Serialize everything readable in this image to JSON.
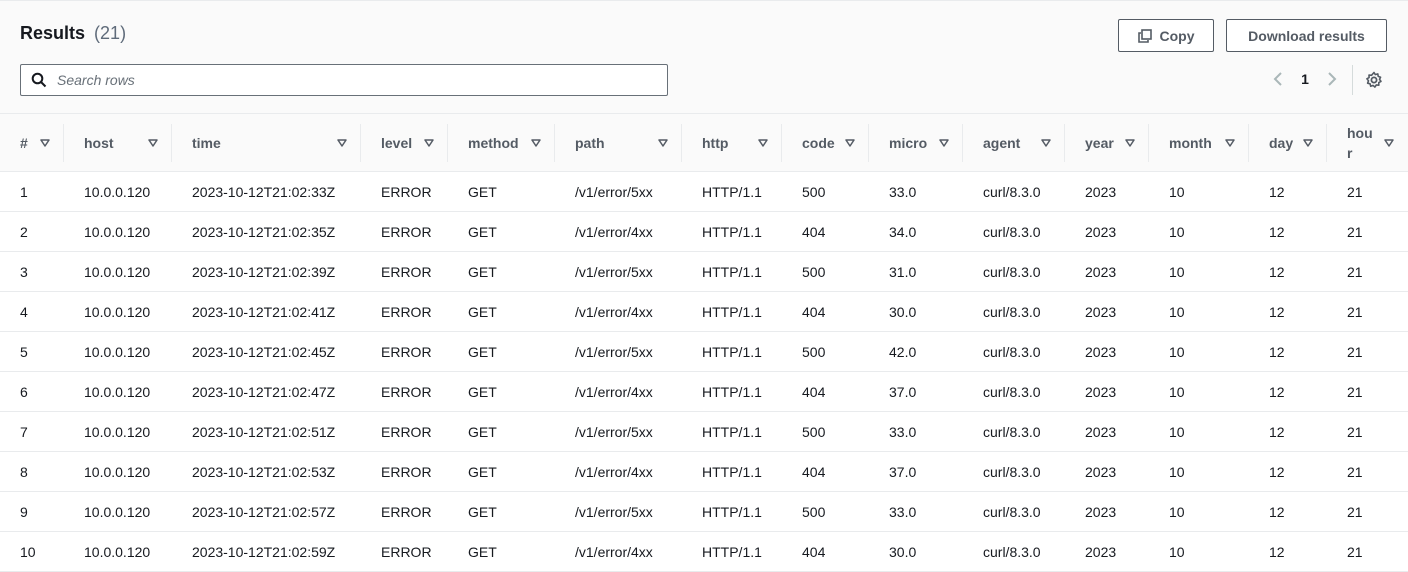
{
  "results": {
    "title": "Results",
    "count": "(21)"
  },
  "toolbar": {
    "copy_label": "Copy",
    "download_label": "Download results"
  },
  "search": {
    "placeholder": "Search rows",
    "value": ""
  },
  "pagination": {
    "current_page": "1"
  },
  "columns": [
    "#",
    "host",
    "time",
    "level",
    "method",
    "path",
    "http",
    "code",
    "micro",
    "agent",
    "year",
    "month",
    "day",
    "hour"
  ],
  "rows": [
    [
      "1",
      "10.0.0.120",
      "2023-10-12T21:02:33Z",
      "ERROR",
      "GET",
      "/v1/error/5xx",
      "HTTP/1.1",
      "500",
      "33.0",
      "curl/8.3.0",
      "2023",
      "10",
      "12",
      "21"
    ],
    [
      "2",
      "10.0.0.120",
      "2023-10-12T21:02:35Z",
      "ERROR",
      "GET",
      "/v1/error/4xx",
      "HTTP/1.1",
      "404",
      "34.0",
      "curl/8.3.0",
      "2023",
      "10",
      "12",
      "21"
    ],
    [
      "3",
      "10.0.0.120",
      "2023-10-12T21:02:39Z",
      "ERROR",
      "GET",
      "/v1/error/5xx",
      "HTTP/1.1",
      "500",
      "31.0",
      "curl/8.3.0",
      "2023",
      "10",
      "12",
      "21"
    ],
    [
      "4",
      "10.0.0.120",
      "2023-10-12T21:02:41Z",
      "ERROR",
      "GET",
      "/v1/error/4xx",
      "HTTP/1.1",
      "404",
      "30.0",
      "curl/8.3.0",
      "2023",
      "10",
      "12",
      "21"
    ],
    [
      "5",
      "10.0.0.120",
      "2023-10-12T21:02:45Z",
      "ERROR",
      "GET",
      "/v1/error/5xx",
      "HTTP/1.1",
      "500",
      "42.0",
      "curl/8.3.0",
      "2023",
      "10",
      "12",
      "21"
    ],
    [
      "6",
      "10.0.0.120",
      "2023-10-12T21:02:47Z",
      "ERROR",
      "GET",
      "/v1/error/4xx",
      "HTTP/1.1",
      "404",
      "37.0",
      "curl/8.3.0",
      "2023",
      "10",
      "12",
      "21"
    ],
    [
      "7",
      "10.0.0.120",
      "2023-10-12T21:02:51Z",
      "ERROR",
      "GET",
      "/v1/error/5xx",
      "HTTP/1.1",
      "500",
      "33.0",
      "curl/8.3.0",
      "2023",
      "10",
      "12",
      "21"
    ],
    [
      "8",
      "10.0.0.120",
      "2023-10-12T21:02:53Z",
      "ERROR",
      "GET",
      "/v1/error/4xx",
      "HTTP/1.1",
      "404",
      "37.0",
      "curl/8.3.0",
      "2023",
      "10",
      "12",
      "21"
    ],
    [
      "9",
      "10.0.0.120",
      "2023-10-12T21:02:57Z",
      "ERROR",
      "GET",
      "/v1/error/5xx",
      "HTTP/1.1",
      "500",
      "33.0",
      "curl/8.3.0",
      "2023",
      "10",
      "12",
      "21"
    ],
    [
      "10",
      "10.0.0.120",
      "2023-10-12T21:02:59Z",
      "ERROR",
      "GET",
      "/v1/error/4xx",
      "HTTP/1.1",
      "404",
      "30.0",
      "curl/8.3.0",
      "2023",
      "10",
      "12",
      "21"
    ]
  ],
  "icons": {
    "copy": "copy-icon",
    "search": "search-icon",
    "prev": "chevron-left-icon",
    "next": "chevron-right-icon",
    "settings": "gear-icon",
    "sort": "caret-down-icon"
  },
  "colors": {
    "header_bg": "#fafafa",
    "text": "#16191f",
    "muted": "#545b64",
    "border": "#e9ebed"
  }
}
